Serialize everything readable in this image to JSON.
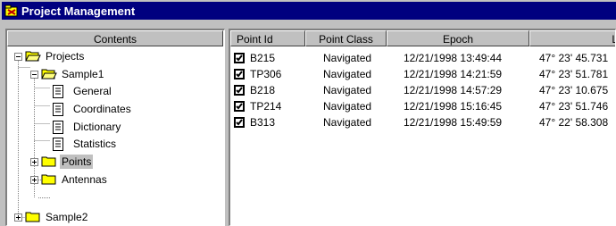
{
  "window": {
    "title": "Project Management",
    "icon": "app-icon"
  },
  "tree": {
    "header": "Contents",
    "nodes": [
      {
        "label": "Projects",
        "icon": "folder-open-icon",
        "expander": "minus"
      },
      {
        "label": "Sample1",
        "icon": "folder-open-icon",
        "expander": "minus"
      },
      {
        "label": "General",
        "icon": "document-icon"
      },
      {
        "label": "Coordinates",
        "icon": "document-icon"
      },
      {
        "label": "Dictionary",
        "icon": "document-icon"
      },
      {
        "label": "Statistics",
        "icon": "document-icon"
      },
      {
        "label": "Points",
        "icon": "folder-icon",
        "expander": "plus",
        "selected": true
      },
      {
        "label": "Antennas",
        "icon": "folder-icon",
        "expander": "plus"
      },
      {
        "label": "Sample2",
        "icon": "folder-icon",
        "expander": "plus"
      }
    ]
  },
  "table": {
    "columns": [
      "Point Id",
      "Point Class",
      "Epoch",
      "L"
    ],
    "rows": [
      {
        "checked": true,
        "point_id": "B215",
        "point_class": "Navigated",
        "epoch": "12/21/1998 13:49:44",
        "lat": "47° 23' 45.731"
      },
      {
        "checked": true,
        "point_id": "TP306",
        "point_class": "Navigated",
        "epoch": "12/21/1998 14:21:59",
        "lat": "47° 23' 51.781"
      },
      {
        "checked": true,
        "point_id": "B218",
        "point_class": "Navigated",
        "epoch": "12/21/1998 14:57:29",
        "lat": "47° 23' 10.675"
      },
      {
        "checked": true,
        "point_id": "TP214",
        "point_class": "Navigated",
        "epoch": "12/21/1998 15:16:45",
        "lat": "47° 23' 51.746"
      },
      {
        "checked": true,
        "point_id": "B313",
        "point_class": "Navigated",
        "epoch": "12/21/1998 15:49:59",
        "lat": "47° 22' 58.308"
      }
    ]
  },
  "colors": {
    "titlebar": "#00007f",
    "face": "#c0c0c0",
    "folder": "#ffff00"
  }
}
